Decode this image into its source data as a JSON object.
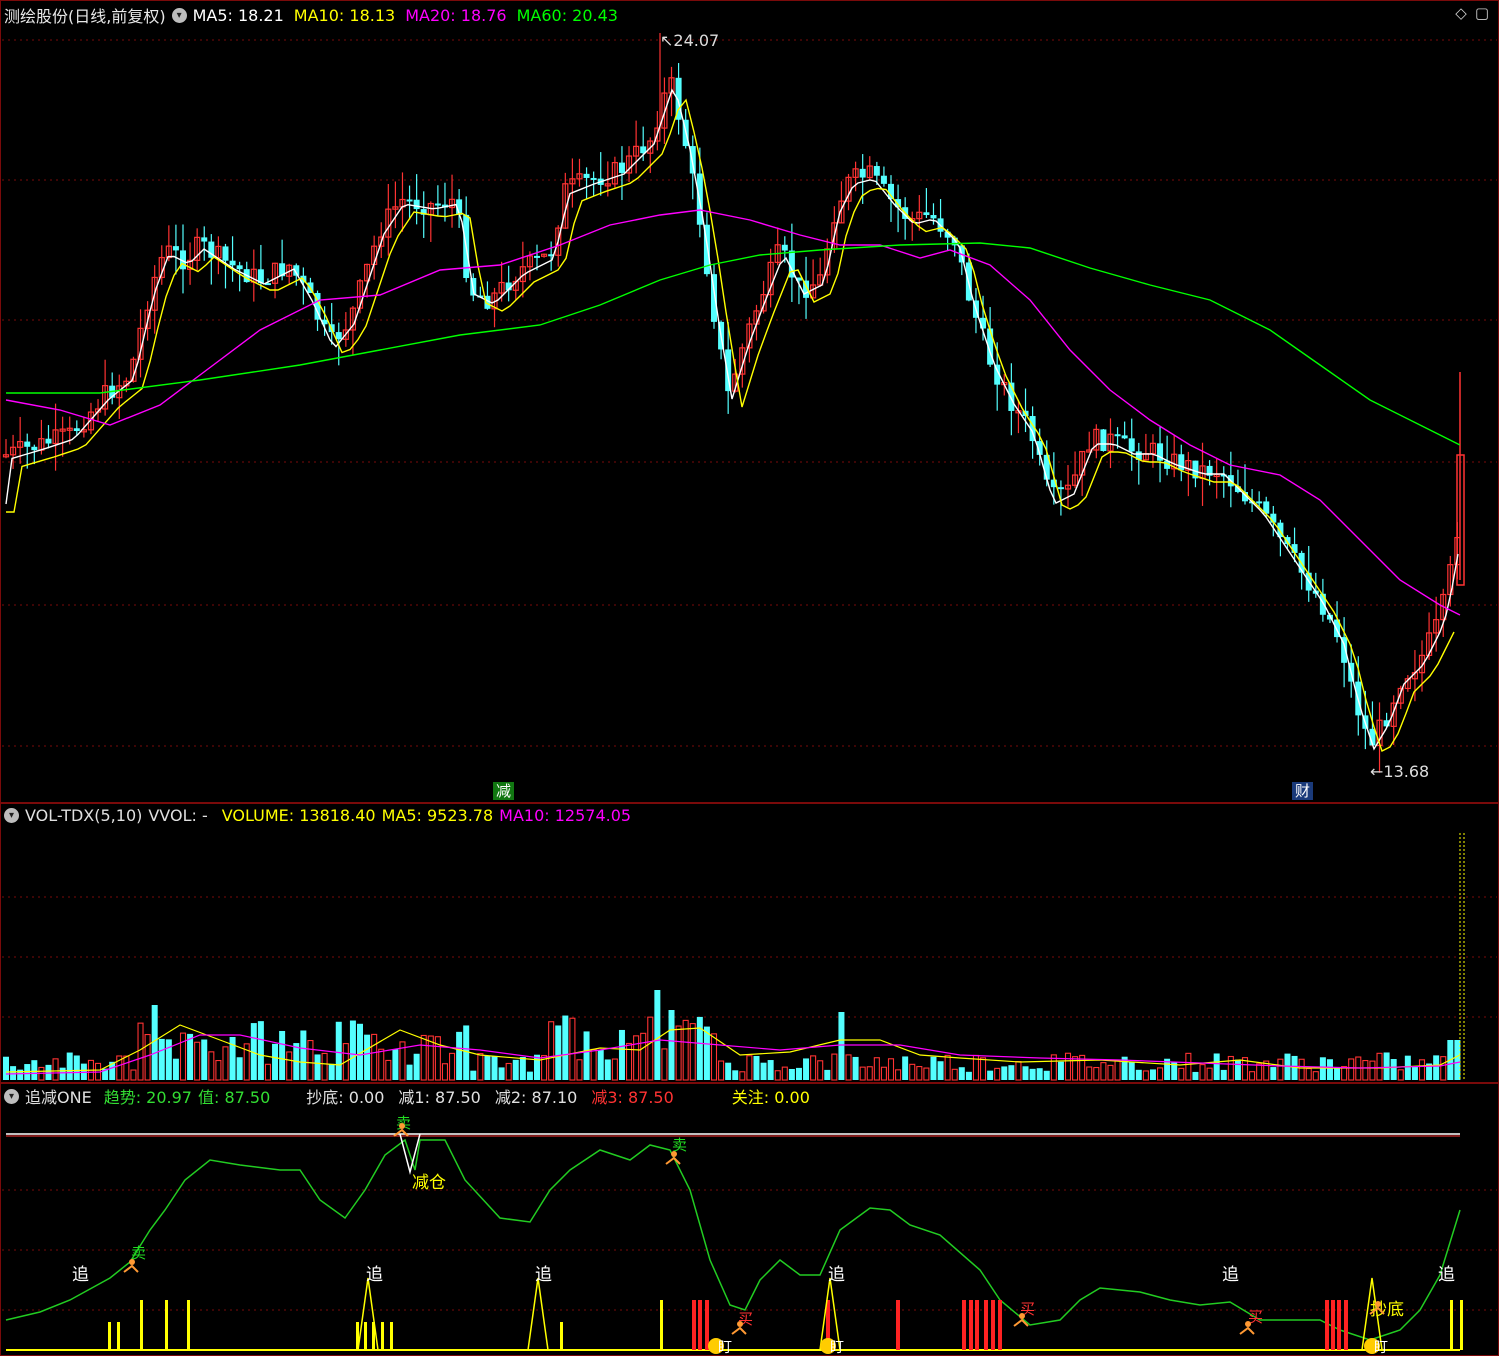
{
  "main_panel": {
    "title": "测绘股份(日线,前复权)",
    "ma_labels": [
      {
        "text": "MA5: 18.21",
        "color": "#ffffff"
      },
      {
        "text": "MA10: 18.13",
        "color": "#ffff00"
      },
      {
        "text": "MA20: 18.76",
        "color": "#ff00ff"
      },
      {
        "text": "MA60: 20.43",
        "color": "#00ff00"
      }
    ],
    "high_label": "24.07",
    "low_label": "13.68",
    "marker_jian": "减",
    "marker_cai": "财",
    "corner_icons": [
      "diamond-icon",
      "window-icon"
    ]
  },
  "vol_panel": {
    "name": "VOL-TDX(5,10)",
    "vvol": "VVOL: -",
    "volume": "VOLUME: 13818.40",
    "ma5": "MA5: 9523.78",
    "ma10": "MA10: 12574.05"
  },
  "ind_panel": {
    "name": "追减ONE",
    "trend": "趋势: 20.97",
    "value": "值: 87.50",
    "bottom": "抄底: 0.00",
    "jian1": "减1: 87.50",
    "jian2": "减2: 87.10",
    "jian3": "减3: 87.50",
    "focus": "关注: 0.00",
    "labels": {
      "zhui": "追",
      "mai": "卖",
      "mai_buy": "买",
      "jiancang": "减仓",
      "chaodi": "抄底",
      "ding": "盯"
    }
  },
  "colors": {
    "up": "#ff3333",
    "down": "#54ffff",
    "ma5": "#ffffff",
    "ma10": "#ffff00",
    "ma20": "#ff00ff",
    "ma60": "#00ff00",
    "grid": "#7a0a0a"
  }
}
